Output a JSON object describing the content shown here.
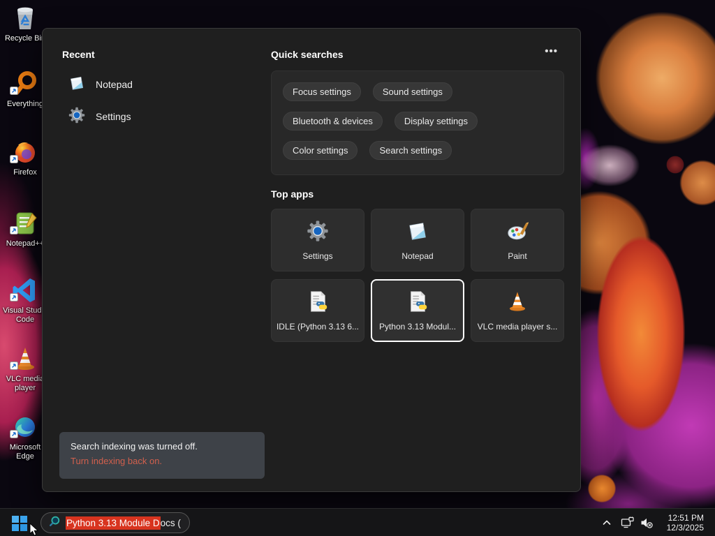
{
  "desktop": {
    "icons": [
      {
        "label": "Recycle Bin"
      },
      {
        "label": "Everything"
      },
      {
        "label": "Firefox"
      },
      {
        "label": "Notepad++"
      },
      {
        "label": "Visual Studio Code"
      },
      {
        "label": "VLC media player"
      },
      {
        "label": "Microsoft Edge"
      }
    ]
  },
  "search_panel": {
    "recent": {
      "header": "Recent",
      "items": [
        {
          "label": "Notepad"
        },
        {
          "label": "Settings"
        }
      ]
    },
    "quick_searches": {
      "header": "Quick searches",
      "more_label": "•••",
      "pills": [
        "Focus settings",
        "Sound settings",
        "Bluetooth & devices",
        "Display settings",
        "Color settings",
        "Search settings"
      ]
    },
    "top_apps": {
      "header": "Top apps",
      "tiles": [
        {
          "label": "Settings"
        },
        {
          "label": "Notepad"
        },
        {
          "label": "Paint"
        },
        {
          "label": "IDLE (Python 3.13 6..."
        },
        {
          "label": "Python 3.13 Modul...",
          "selected": true
        },
        {
          "label": "VLC media player s..."
        }
      ]
    },
    "notice": {
      "line1": "Search indexing was turned off.",
      "line2": "Turn indexing back on."
    }
  },
  "taskbar": {
    "search": {
      "selected_text": "Python 3.13 Module D",
      "rest_text": "ocs ("
    },
    "tray": {
      "time": "12:51 PM",
      "date": "12/3/2025"
    }
  },
  "colors": {
    "selection_highlight": "#d8341f",
    "notice_link": "#d1604d",
    "panel_bg": "#1f1f1f",
    "accent_blue": "#35a0ee"
  }
}
